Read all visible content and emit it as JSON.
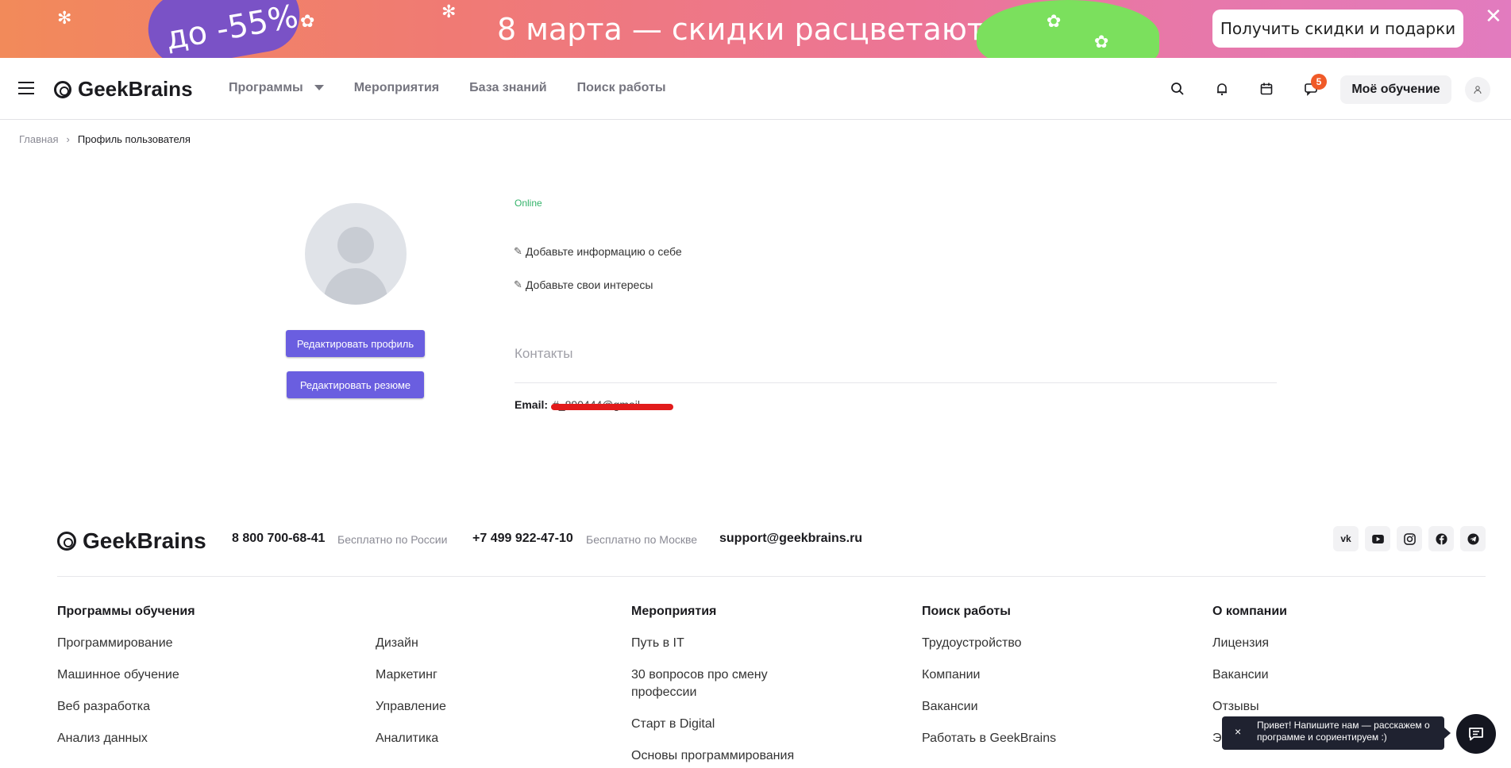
{
  "promo": {
    "discount": "до -55%",
    "title": "8 марта — скидки расцветают",
    "cta": "Получить скидки и подарки",
    "close_icon": "close-icon"
  },
  "header": {
    "logo": "GeekBrains",
    "nav": [
      "Программы",
      "Мероприятия",
      "База знаний",
      "Поиск работы"
    ],
    "icons": [
      "search-icon",
      "bell-icon",
      "calendar-icon",
      "chat-icon"
    ],
    "notification_count": "5",
    "my_learning": "Моё обучение",
    "avatar_icon": "user-icon"
  },
  "breadcrumb": {
    "home": "Главная",
    "separator": "›",
    "current": "Профиль пользователя"
  },
  "profile": {
    "status": "Online",
    "edit_profile": "Редактировать профиль",
    "edit_resume": "Редактировать резюме",
    "add_info": "Добавьте информацию о себе",
    "add_interests": "Добавьте свои интересы",
    "contacts_title": "Контакты",
    "email_label": "Email:",
    "email_value": "#_890444@gmail"
  },
  "footer": {
    "logo": "GeekBrains",
    "phone1": "8 800 700-68-41",
    "phone1_note": "Бесплатно по России",
    "phone2": "+7 499 922-47-10",
    "phone2_note": "Бесплатно по Москве",
    "support": "support@geekbrains.ru",
    "social": [
      "vk",
      "youtube",
      "instagram",
      "facebook",
      "telegram"
    ],
    "programs_title": "Программы обучения",
    "programs_col1": [
      "Программирование",
      "Машинное обучение",
      "Веб разработка",
      "Анализ данных"
    ],
    "programs_col2": [
      "Дизайн",
      "Маркетинг",
      "Управление",
      "Аналитика"
    ],
    "events_title": "Мероприятия",
    "events": [
      "Путь в IT",
      "30 вопросов про смену",
      "профессии",
      "Старт в Digital",
      "Основы программирования"
    ],
    "jobs_title": "Поиск работы",
    "jobs": [
      "Трудоустройство",
      "Компании",
      "Вакансии",
      "Работать в GeekBrains"
    ],
    "company_title": "О компании",
    "company": [
      "Лицензия",
      "Вакансии",
      "Отзывы",
      "Э"
    ]
  },
  "chat": {
    "tip": "Привет! Напишите нам — расскажем о программе и сориентируем :)",
    "close": "×"
  },
  "colors": {
    "accent": "#6a5ee0",
    "online": "#34b36a",
    "badge": "#f05a28"
  }
}
